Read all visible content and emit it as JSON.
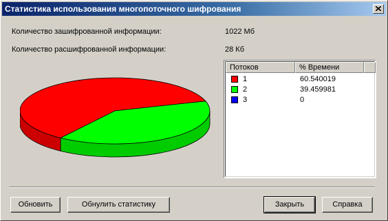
{
  "window": {
    "title": "Статистика использования многопоточного шифрования"
  },
  "stats": {
    "encrypted_label": "Количество зашифрованной информации:",
    "encrypted_value": "1022 Мб",
    "decrypted_label": "Количество расшифрованной информации:",
    "decrypted_value": "28 Кб"
  },
  "table": {
    "columns": [
      "Потоков",
      "% Времени"
    ],
    "rows": [
      {
        "threads": "1",
        "percent": "60.540019",
        "color": "#ff0000"
      },
      {
        "threads": "2",
        "percent": "39.459981",
        "color": "#00ff00"
      },
      {
        "threads": "3",
        "percent": "0",
        "color": "#0000ff"
      }
    ]
  },
  "chart_data": {
    "type": "pie",
    "categories": [
      "1",
      "2",
      "3"
    ],
    "values": [
      60.540019,
      39.459981,
      0
    ],
    "colors": [
      "#ff0000",
      "#00ff00",
      "#0000ff"
    ],
    "style": "3d"
  },
  "buttons": {
    "refresh": "Обновить",
    "reset": "Обнулить статистику",
    "close": "Закрыть",
    "help": "Справка"
  },
  "icons": {
    "close": "close-icon"
  }
}
